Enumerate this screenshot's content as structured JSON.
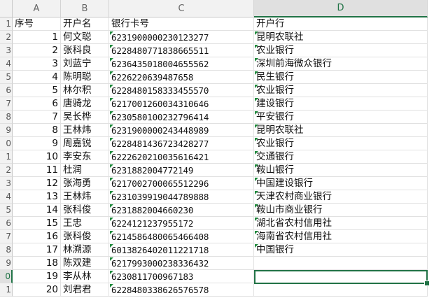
{
  "columns": [
    "A",
    "B",
    "C",
    "D"
  ],
  "active_column": "D",
  "active_row": "20",
  "row_numbers": [
    "1",
    "2",
    "3",
    "4",
    "5",
    "6",
    "7",
    "8",
    "9",
    "0",
    "1",
    "2",
    "3",
    "4",
    "5",
    "6",
    "7",
    "8",
    "9",
    "0",
    "1"
  ],
  "header_row": {
    "seq": "序号",
    "name": "开户名",
    "card": "银行卡号",
    "bank": "开户行"
  },
  "rows": [
    {
      "seq": "1",
      "name": "何文聪",
      "card": "6231900000230123277",
      "bank": "昆明农联社"
    },
    {
      "seq": "2",
      "name": "张科良",
      "card": "6228480771838665511",
      "bank": "农业银行"
    },
    {
      "seq": "3",
      "name": "刘蓝宁",
      "card": "6236435018004655562",
      "bank": "深圳前海微众银行"
    },
    {
      "seq": "4",
      "name": "陈明聪",
      "card": "6226220639487658",
      "bank": "民生银行"
    },
    {
      "seq": "5",
      "name": "林尔积",
      "card": "6228480158333455570",
      "bank": "农业银行"
    },
    {
      "seq": "6",
      "name": "唐骑龙",
      "card": "6217001260034310646",
      "bank": "建设银行"
    },
    {
      "seq": "7",
      "name": "吴长桦",
      "card": "6230580100232796414",
      "bank": "平安银行"
    },
    {
      "seq": "8",
      "name": "王林炜",
      "card": "6231900000243448989",
      "bank": "昆明农联社"
    },
    {
      "seq": "9",
      "name": "周嘉锐",
      "card": "6228481436723428277",
      "bank": "农业银行"
    },
    {
      "seq": "10",
      "name": "李安东",
      "card": "6222620210035616421",
      "bank": "交通银行"
    },
    {
      "seq": "11",
      "name": "杜润",
      "card": "6231882004772149",
      "bank": "鞍山银行"
    },
    {
      "seq": "12",
      "name": "张海勇",
      "card": "6217002700065512296",
      "bank": "中国建设银行"
    },
    {
      "seq": "13",
      "name": "王林炜",
      "card": "6231039919044789888",
      "bank": "天津农村商业银行"
    },
    {
      "seq": "14",
      "name": "张科俊",
      "card": "6231882004660230",
      "bank": "鞍山市商业银行"
    },
    {
      "seq": "15",
      "name": "王忠",
      "card": "6224121237955172",
      "bank": "湖北省农村信用社"
    },
    {
      "seq": "16",
      "name": "张科俊",
      "card": "6214586480065466408",
      "bank": "海南省农村信用社"
    },
    {
      "seq": "17",
      "name": "林溯源",
      "card": "6013826402011221718",
      "bank": "中国银行"
    },
    {
      "seq": "18",
      "name": "陈双建",
      "card": "6217993000238336432",
      "bank": ""
    },
    {
      "seq": "19",
      "name": "李从林",
      "card": "6230811700967183",
      "bank": ""
    },
    {
      "seq": "20",
      "name": "刘君君",
      "card": "6228480338626576578",
      "bank": ""
    }
  ],
  "colors": {
    "accent": "#217346",
    "error_triangle": "#1f8a3c"
  }
}
